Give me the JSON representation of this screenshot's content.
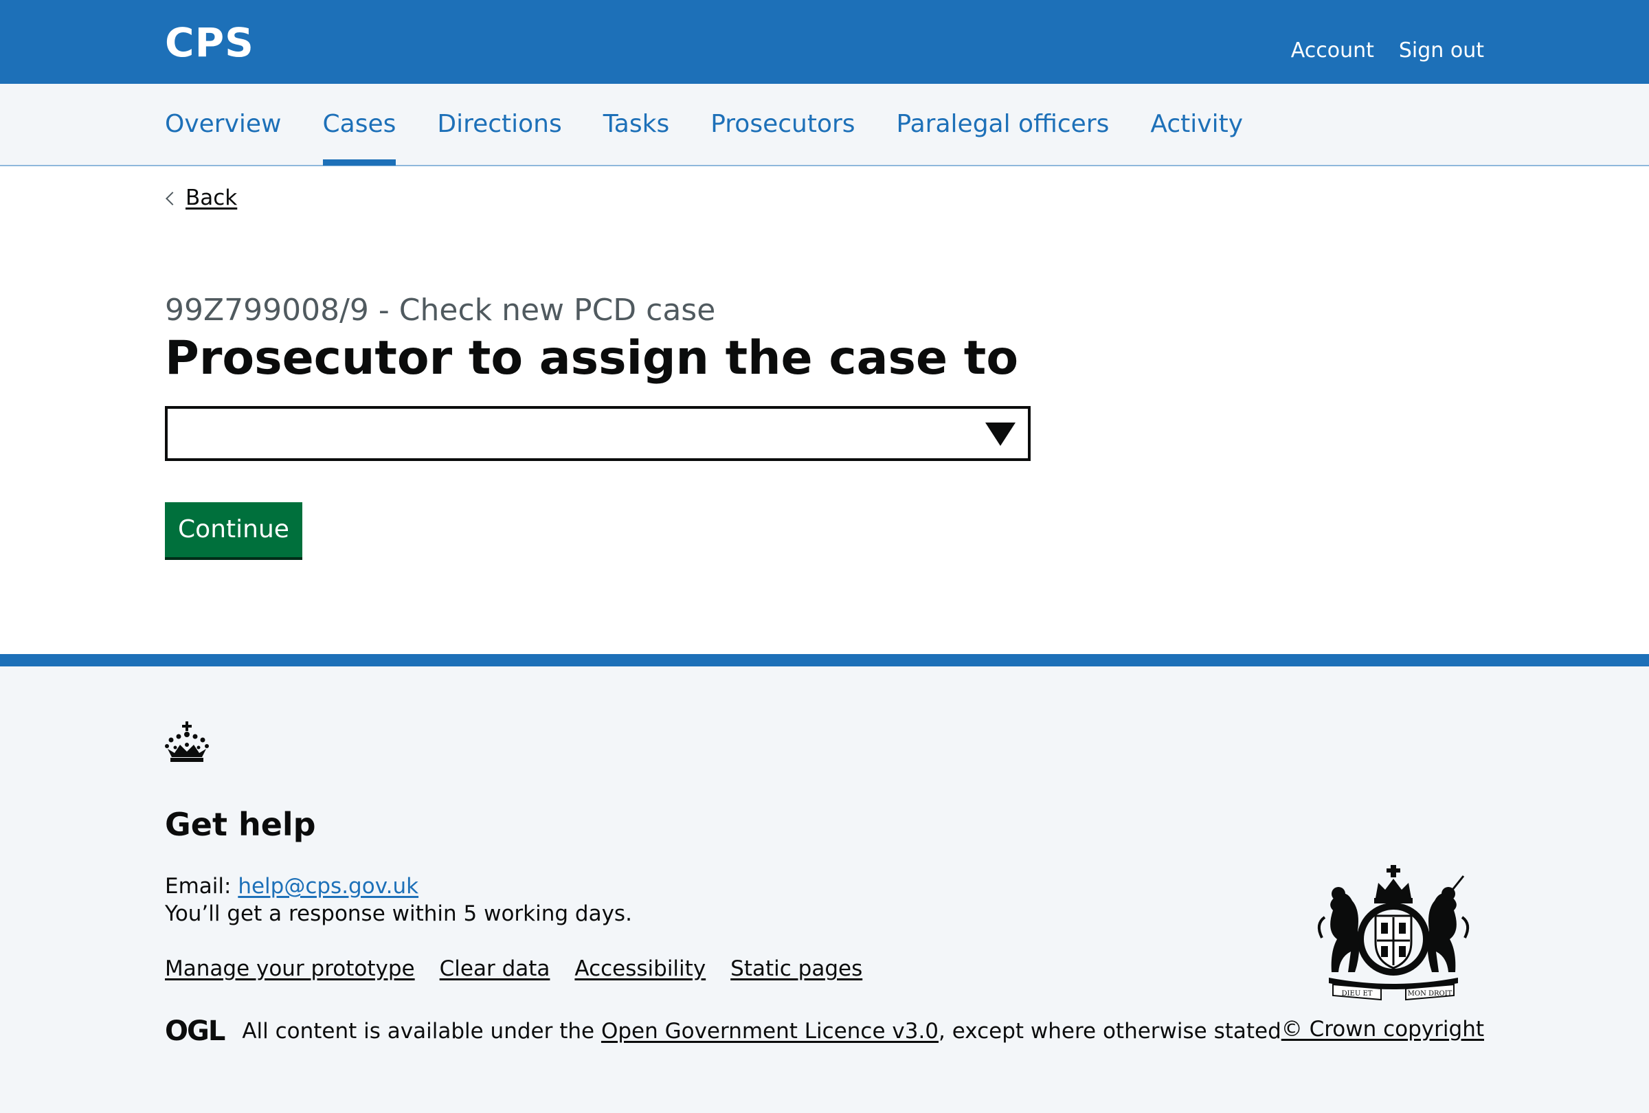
{
  "header": {
    "logo": "CPS",
    "links": [
      "Account",
      "Sign out"
    ]
  },
  "nav": {
    "items": [
      "Overview",
      "Cases",
      "Directions",
      "Tasks",
      "Prosecutors",
      "Paralegal officers",
      "Activity"
    ],
    "active": "Cases"
  },
  "back_label": "Back",
  "main": {
    "caption": "99Z799008/9 - Check new PCD case",
    "title": "Prosecutor to assign the case to",
    "select_value": "",
    "continue_label": "Continue"
  },
  "footer": {
    "get_help": "Get help",
    "email_label": "Email:",
    "email": "help@cps.gov.uk",
    "response": "You’ll get a response within 5 working days.",
    "links": [
      "Manage your prototype",
      "Clear data",
      "Accessibility",
      "Static pages"
    ],
    "ogl_logo": "OGL",
    "licence_prefix": "All content is available under the ",
    "licence_link": "Open Government Licence v3.0",
    "licence_suffix": ", except where otherwise stated",
    "copyright": "© Crown copyright",
    "arms_motto_left": "DIEU ET",
    "arms_motto_right": "MON DROIT"
  },
  "colors": {
    "brand_blue": "#1d70b8",
    "button_green": "#00703c",
    "footer_bg": "#f3f6f9"
  }
}
